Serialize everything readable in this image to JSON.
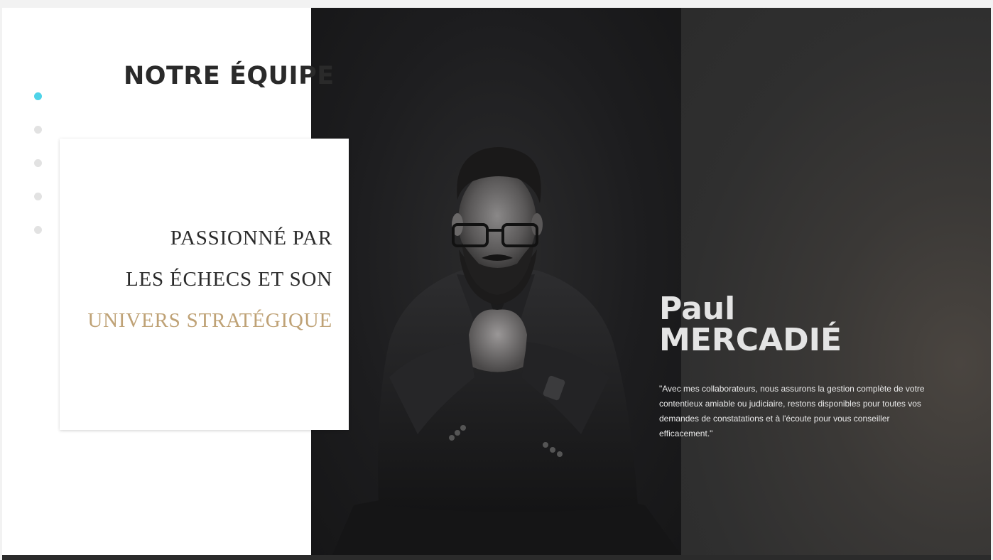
{
  "section": {
    "title": "NOTRE ÉQUIPE"
  },
  "pagination": {
    "count": 5,
    "active_index": 0,
    "active_color": "#4fd3e8",
    "inactive_color": "#e2e2e2"
  },
  "card": {
    "line1": "PASSIONNÉ PAR",
    "line2": "LES ÉCHECS ET SON",
    "line3": "UNIVERS STRATÉGIQUE",
    "accent_color": "#bfa276"
  },
  "member": {
    "first_name": "Paul",
    "last_name": "MERCADIÉ",
    "quote": "\"Avec mes collaborateurs, nous assurons la gestion complète de votre contentieux amiable ou judiciaire, restons disponibles pour toutes vos demandes de constatations et à l'écoute pour vous conseiller efficacement.\""
  },
  "photo": {
    "icon": "team-member-portrait"
  }
}
